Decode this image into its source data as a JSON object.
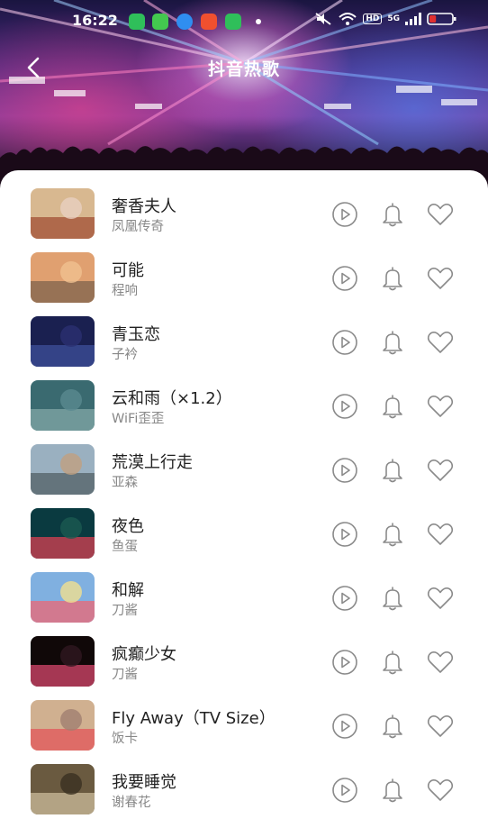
{
  "status": {
    "time": "16:22",
    "hd_label": "HD",
    "network_label": "5G",
    "battery_level": 0.3
  },
  "header": {
    "title": "抖音热歌"
  },
  "songs": [
    {
      "title": "奢香夫人",
      "artist": "凤凰传奇",
      "cover_colors": [
        "#d8b890",
        "#a85a40",
        "#e8d0c0"
      ]
    },
    {
      "title": "可能",
      "artist": "程响",
      "cover_colors": [
        "#e0a070",
        "#8a6a50",
        "#f0c090"
      ]
    },
    {
      "title": "青玉恋",
      "artist": "子衿",
      "cover_colors": [
        "#1a2050",
        "#3a4a90",
        "#2a3070"
      ]
    },
    {
      "title": "云和雨（×1.2）",
      "artist": "WiFi歪歪",
      "cover_colors": [
        "#3a6a70",
        "#7aa0a0",
        "#5a8a90"
      ]
    },
    {
      "title": "荒漠上行走",
      "artist": "亚森",
      "cover_colors": [
        "#9ab0c0",
        "#5a6a70",
        "#c0a080"
      ]
    },
    {
      "title": "夜色",
      "artist": "鱼蛋",
      "cover_colors": [
        "#0a3a40",
        "#c04050",
        "#1a5a50"
      ]
    },
    {
      "title": "和解",
      "artist": "刀酱",
      "cover_colors": [
        "#80b0e0",
        "#e07080",
        "#f0e090"
      ]
    },
    {
      "title": "疯癫少女",
      "artist": "刀酱",
      "cover_colors": [
        "#100808",
        "#c04060",
        "#301820"
      ]
    },
    {
      "title": "Fly Away（TV Size）",
      "artist": "饭卡",
      "cover_colors": [
        "#d0b090",
        "#e06060",
        "#a08070"
      ]
    },
    {
      "title": "我要睡觉",
      "artist": "谢春花",
      "cover_colors": [
        "#6a5a40",
        "#c0b090",
        "#3a3020"
      ]
    }
  ],
  "icons": {
    "play": "play-circle-icon",
    "bell": "bell-icon",
    "heart": "heart-icon",
    "back": "chevron-left-icon"
  },
  "colors": {
    "icon_gray": "#8a8a8a",
    "title_text": "#222222",
    "subtitle_text": "#888888"
  }
}
